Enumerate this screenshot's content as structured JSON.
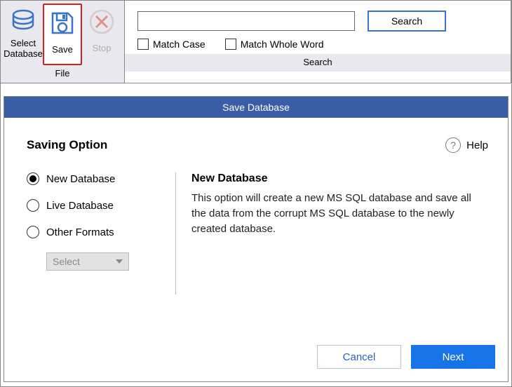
{
  "ribbon": {
    "file": {
      "select_db_label": "Select Database",
      "save_label": "Save",
      "stop_label": "Stop",
      "caption": "File"
    },
    "search": {
      "placeholder": "",
      "search_button": "Search",
      "match_case_label": "Match Case",
      "match_whole_label": "Match Whole Word",
      "caption": "Search"
    }
  },
  "dialog": {
    "title": "Save Database",
    "heading": "Saving Option",
    "help_label": "Help",
    "options": {
      "new_db": "New Database",
      "live_db": "Live Database",
      "other_formats": "Other Formats",
      "select_placeholder": "Select"
    },
    "description": {
      "title": "New Database",
      "text": "This option will create a new MS SQL database and save all the data from the corrupt MS SQL database to the newly created database."
    },
    "footer": {
      "cancel": "Cancel",
      "next": "Next"
    }
  }
}
